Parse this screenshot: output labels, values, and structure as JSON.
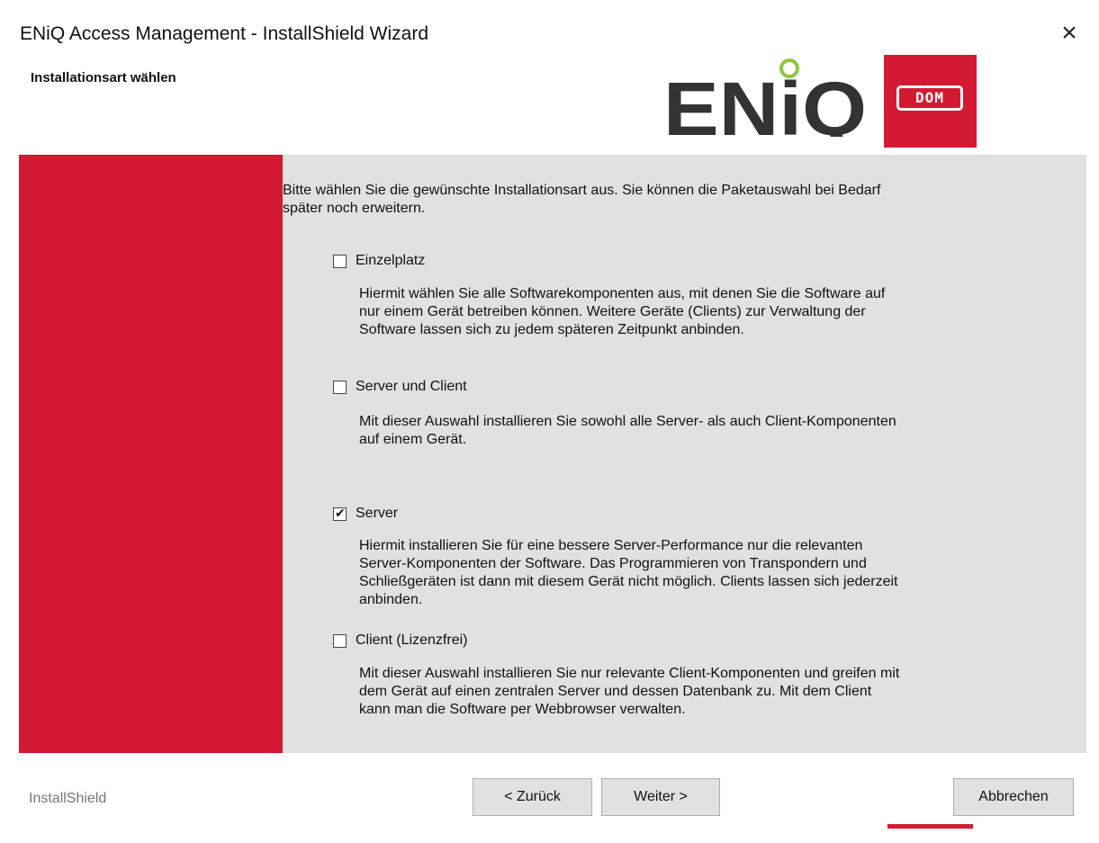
{
  "window": {
    "title": "ENiQ Access Management - InstallShield Wizard",
    "close_icon": "×"
  },
  "header": {
    "subtitle": "Installationsart wählen",
    "logo_text": "ENiQ",
    "brand_badge": "DOM"
  },
  "content": {
    "intro_line1": "Bitte wählen Sie die gewünschte Installationsart aus. Sie können die Paketauswahl bei Bedarf",
    "intro_line2": "später noch erweitern.",
    "options": [
      {
        "label": "Einzelplatz",
        "checked": false,
        "desc": [
          "Hiermit wählen Sie alle Softwarekomponenten aus, mit denen Sie die Software auf",
          "nur einem Gerät betreiben können. Weitere Geräte (Clients) zur Verwaltung der",
          "Software lassen sich zu jedem späteren Zeitpunkt anbinden."
        ]
      },
      {
        "label": "Server und Client",
        "checked": false,
        "desc": [
          "Mit dieser Auswahl installieren Sie sowohl alle Server- als auch Client-Komponenten",
          "auf einem Gerät."
        ]
      },
      {
        "label": "Server",
        "checked": true,
        "desc": [
          "Hiermit installieren Sie für eine bessere Server-Performance nur die relevanten",
          "Server-Komponenten der Software. Das Programmieren von Transpondern und",
          "Schließgeräten ist dann mit diesem Gerät nicht möglich. Clients lassen sich jederzeit",
          "anbinden."
        ]
      },
      {
        "label": "Client (Lizenzfrei)",
        "checked": false,
        "desc": [
          "Mit dieser Auswahl installieren Sie nur relevante Client-Komponenten und greifen mit",
          "dem Gerät auf einen zentralen Server und dessen Datenbank zu. Mit dem Client",
          "kann man die Software per Webbrowser verwalten."
        ]
      }
    ]
  },
  "footer": {
    "brand": "InstallShield",
    "back_label": "< Zurück",
    "next_label": "Weiter >",
    "cancel_label": "Abbrechen"
  },
  "colors": {
    "accent_red": "#d41a33",
    "panel_gray": "#e1e1e1"
  }
}
